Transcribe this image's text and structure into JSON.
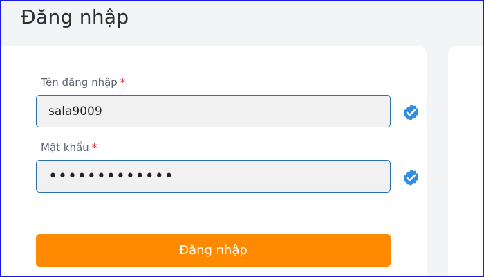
{
  "page": {
    "title": "Đăng nhập"
  },
  "form": {
    "username": {
      "label": "Tên đăng nhập",
      "required_mark": "*",
      "value": "sala9009",
      "verified_icon": "verified-check-icon"
    },
    "password": {
      "label": "Mật khẩu",
      "required_mark": "*",
      "value": "sala900912345",
      "verified_icon": "verified-check-icon"
    },
    "submit_label": "Đăng nhập"
  },
  "colors": {
    "accent": "#ff8a00",
    "input_border": "#2a6fb0",
    "verified": "#2f8de4",
    "required": "#e0263a"
  }
}
